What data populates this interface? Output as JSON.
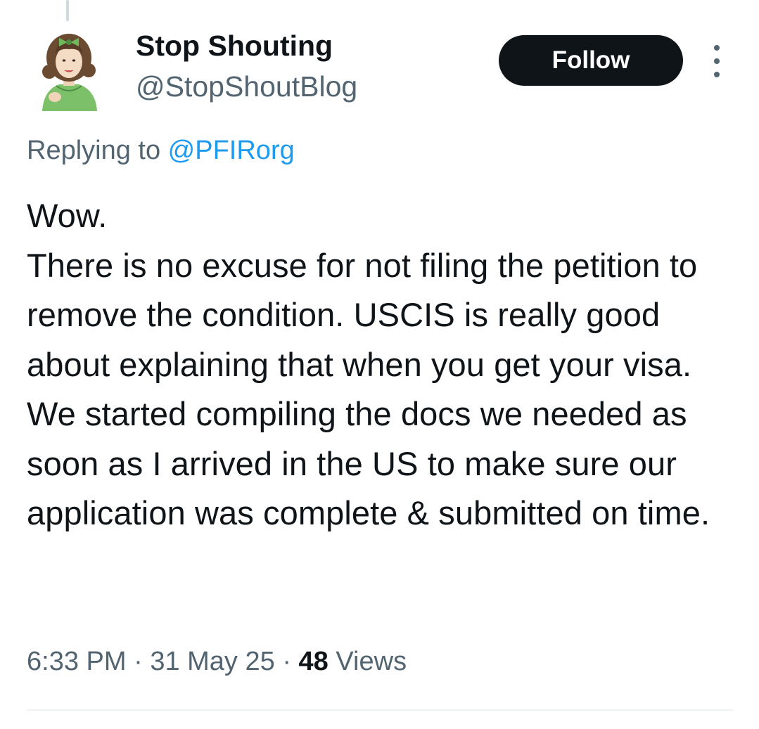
{
  "author": {
    "display_name": "Stop Shouting",
    "handle": "@StopShoutBlog"
  },
  "follow_label": "Follow",
  "reply": {
    "prefix": "Replying to ",
    "mention": "@PFIRorg"
  },
  "tweet": {
    "text": "Wow.\nThere is no excuse for not filing the petition to remove the condition. USCIS is really good about explaining that when you get your visa. We started compiling the docs we needed as soon as I arrived in the US to make sure our application was complete & submitted on time."
  },
  "meta": {
    "time": "6:33 PM",
    "separator": " · ",
    "date": "31 May 25",
    "views_count": "48",
    "views_label": " Views"
  },
  "colors": {
    "text": "#0f1419",
    "secondary": "#536471",
    "link": "#1d9bf0",
    "follow_bg": "#0f1419"
  }
}
